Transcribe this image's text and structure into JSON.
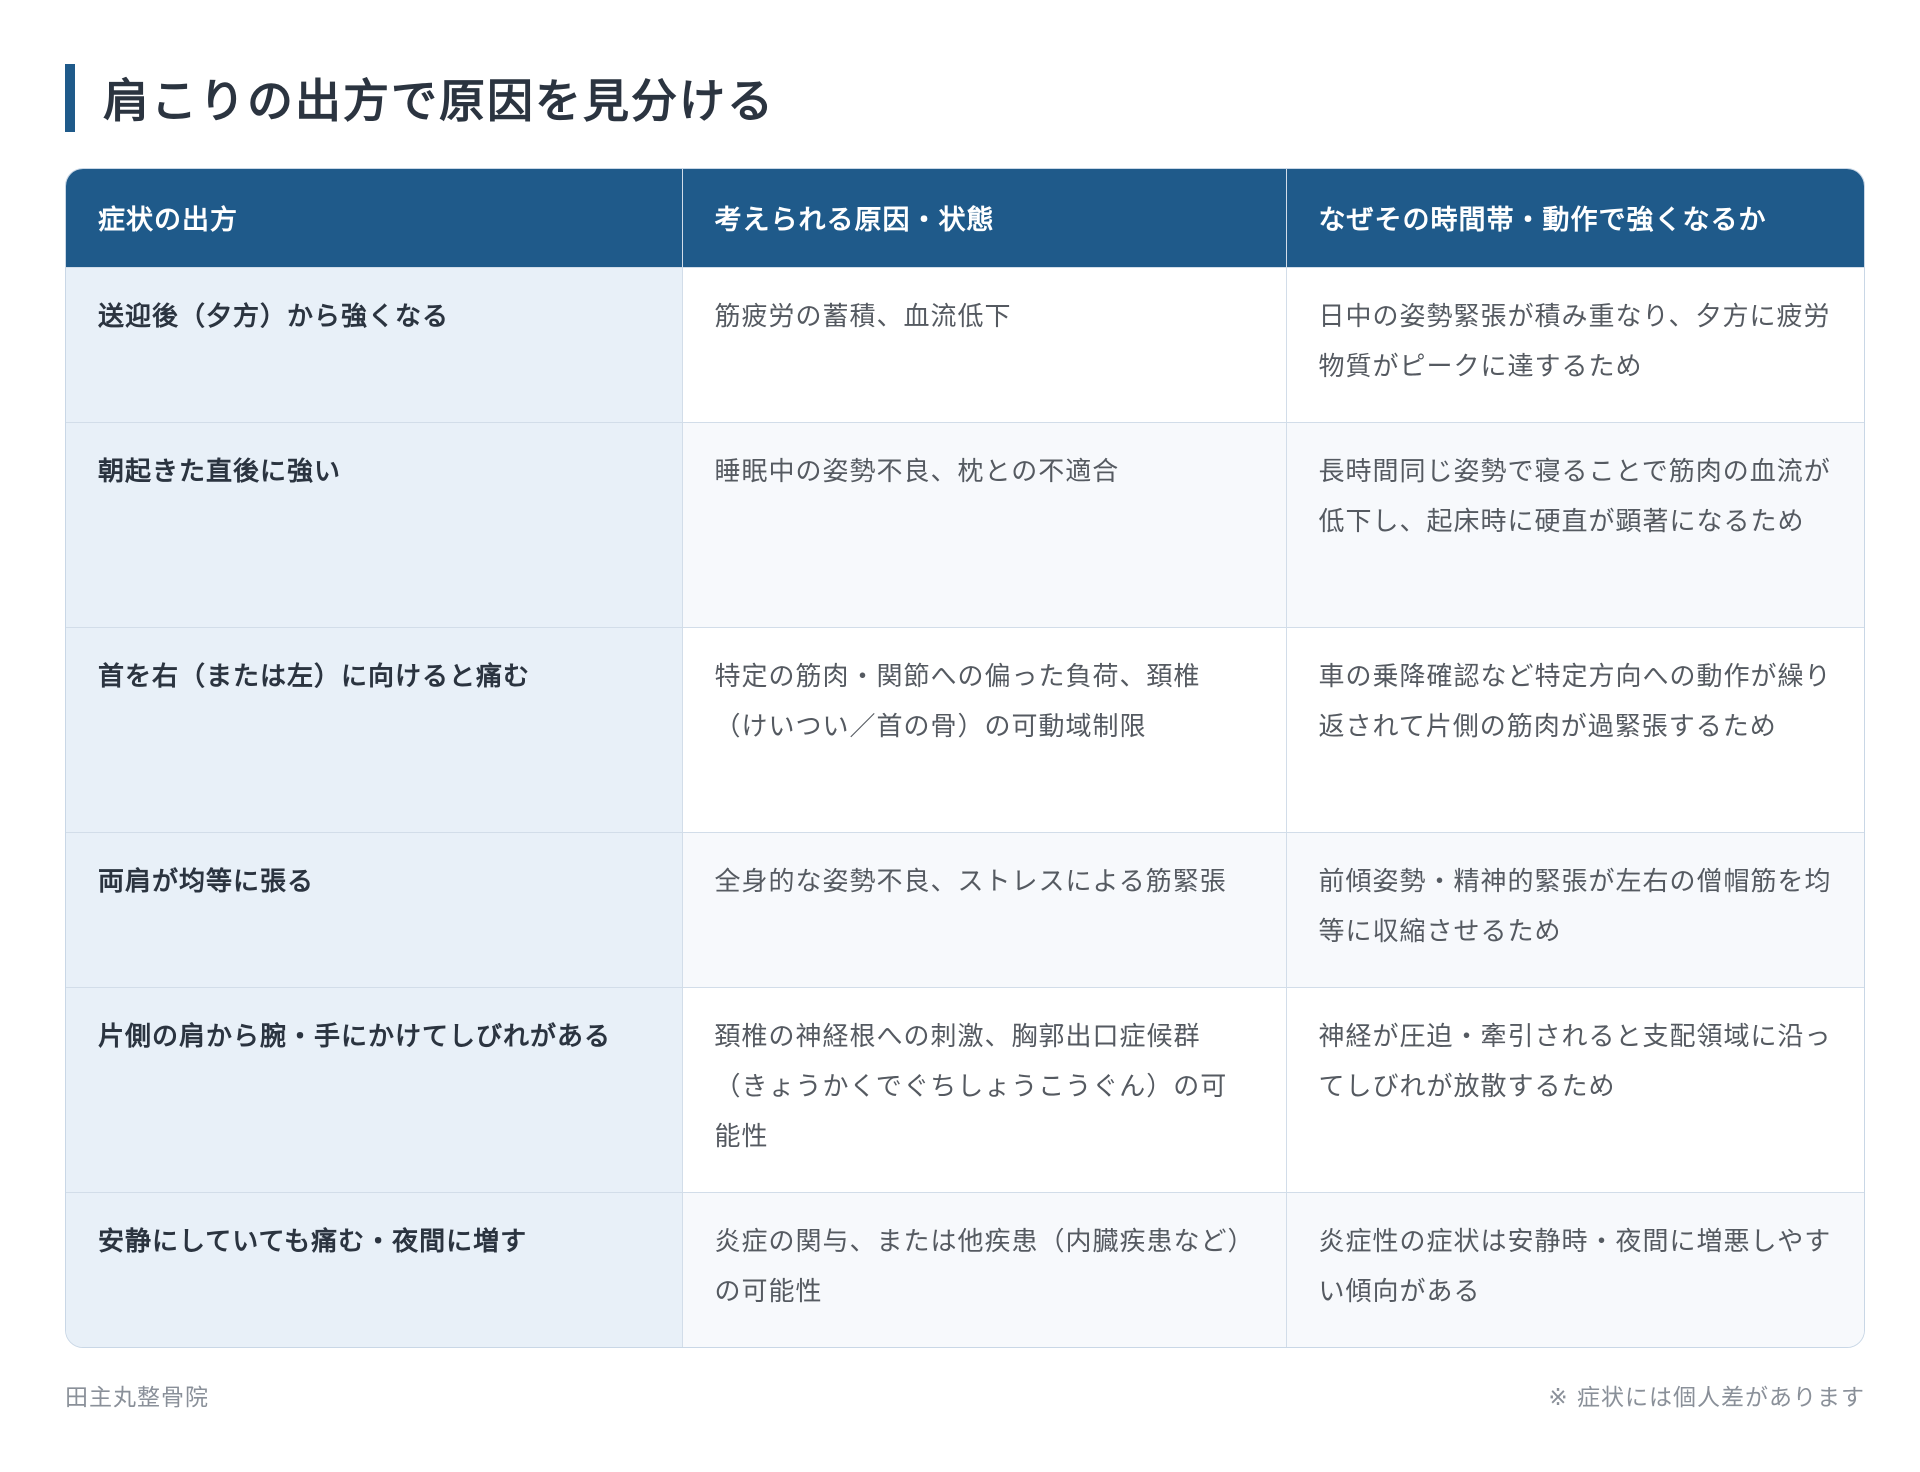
{
  "title": "肩こりの出方で原因を見分ける",
  "table": {
    "headers": [
      "症状の出方",
      "考えられる原因・状態",
      "なぜその時間帯・動作で強くなるか"
    ],
    "rows": [
      [
        "送迎後（夕方）から強くなる",
        "筋疲労の蓄積、血流低下",
        "日中の姿勢緊張が積み重なり、夕方に疲労物質がピークに達するため"
      ],
      [
        "朝起きた直後に強い",
        "睡眠中の姿勢不良、枕との不適合",
        "長時間同じ姿勢で寝ることで筋肉の血流が低下し、起床時に硬直が顕著になるため"
      ],
      [
        "首を右（または左）に向けると痛む",
        "特定の筋肉・関節への偏った負荷、頚椎（けいつい／首の骨）の可動域制限",
        "車の乗降確認など特定方向への動作が繰り返されて片側の筋肉が過緊張するため"
      ],
      [
        "両肩が均等に張る",
        "全身的な姿勢不良、ストレスによる筋緊張",
        "前傾姿勢・精神的緊張が左右の僧帽筋を均等に収縮させるため"
      ],
      [
        "片側の肩から腕・手にかけてしびれがある",
        "頚椎の神経根への刺激、胸郭出口症候群（きょうかくでぐちしょうこうぐん）の可能性",
        "神経が圧迫・牽引されると支配領域に沿ってしびれが放散するため"
      ],
      [
        "安静にしていても痛む・夜間に増す",
        "炎症の関与、または他疾患（内臓疾患など）の可能性",
        "炎症性の症状は安静時・夜間に増悪しやすい傾向がある"
      ]
    ]
  },
  "footer": {
    "left": "田主丸整骨院",
    "right": "※ 症状には個人差があります"
  }
}
